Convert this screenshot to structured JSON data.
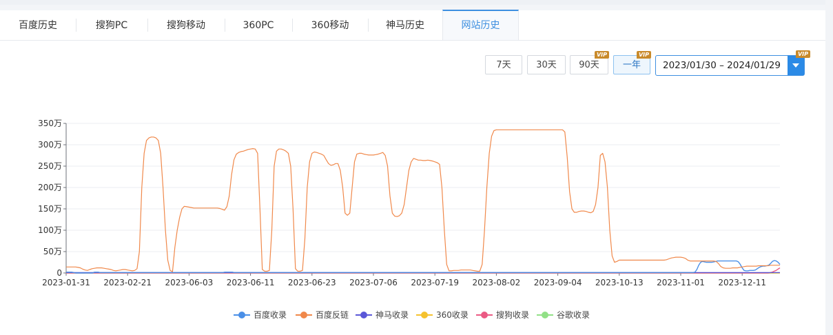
{
  "tabs": [
    {
      "label": "百度历史",
      "active": false
    },
    {
      "label": "搜狗PC",
      "active": false
    },
    {
      "label": "搜狗移动",
      "active": false
    },
    {
      "label": "360PC",
      "active": false
    },
    {
      "label": "360移动",
      "active": false
    },
    {
      "label": "神马历史",
      "active": false
    },
    {
      "label": "网站历史",
      "active": true
    }
  ],
  "range_buttons": [
    {
      "label": "7天",
      "vip": false,
      "selected": false
    },
    {
      "label": "30天",
      "vip": false,
      "selected": false
    },
    {
      "label": "90天",
      "vip": true,
      "selected": false
    },
    {
      "label": "一年",
      "vip": true,
      "selected": true
    }
  ],
  "vip_label": "VIP",
  "date_range": {
    "value": "2023/01/30 – 2024/01/29",
    "vip": true
  },
  "chart_data": {
    "type": "line",
    "ylim": [
      0,
      350
    ],
    "yticks": [
      0,
      50,
      100,
      150,
      200,
      250,
      300,
      350
    ],
    "ytick_labels": [
      "0",
      "50万",
      "100万",
      "150万",
      "200万",
      "250万",
      "300万",
      "350万"
    ],
    "xtick_labels": [
      "2023-01-31",
      "2023-02-21",
      "2023-06-03",
      "2023-06-11",
      "2023-06-23",
      "2023-07-06",
      "2023-07-19",
      "2023-08-02",
      "2023-09-04",
      "2023-10-13",
      "2023-11-01",
      "2023-12-11"
    ],
    "grid": true,
    "legend_position": "bottom",
    "series": [
      {
        "name": "百度收录",
        "color": "#4a8fe7",
        "values": [
          2,
          2,
          2,
          2,
          1,
          0,
          0,
          0,
          0,
          0,
          0,
          0,
          0,
          0,
          0,
          2,
          2,
          2,
          1,
          1,
          1,
          1,
          1,
          1,
          1,
          1,
          1,
          1,
          1,
          1,
          1,
          1,
          1,
          1,
          1,
          1,
          1,
          1,
          1,
          1,
          1,
          1,
          1,
          1,
          1,
          1,
          1,
          1,
          1,
          1,
          1,
          1,
          1,
          1,
          1,
          1,
          1,
          1,
          1,
          1,
          1,
          1,
          1,
          1,
          1,
          1,
          1,
          1,
          1,
          1,
          1,
          1,
          1,
          1,
          1,
          1,
          1,
          1,
          1,
          1,
          1,
          1,
          1,
          1,
          2,
          2,
          2,
          2,
          2,
          1,
          1,
          1,
          1,
          1,
          1,
          1,
          1,
          1,
          1,
          1,
          1,
          1,
          1,
          1,
          1,
          1,
          1,
          1,
          1,
          1,
          1,
          1,
          1,
          1,
          1,
          1,
          1,
          1,
          1,
          1,
          1,
          1,
          1,
          1,
          1,
          1,
          1,
          1,
          1,
          1,
          1,
          1,
          1,
          1,
          1,
          1,
          1,
          1,
          1,
          1,
          1,
          1,
          1,
          1,
          1,
          1,
          1,
          1,
          1,
          1,
          1,
          1,
          1,
          1,
          1,
          1,
          1,
          1,
          1,
          1,
          1,
          1,
          1,
          1,
          1,
          1,
          1,
          1,
          1,
          1,
          1,
          1,
          1,
          1,
          1,
          1,
          1,
          1,
          1,
          1,
          1,
          1,
          1,
          1,
          1,
          1,
          1,
          1,
          1,
          1,
          1,
          1,
          1,
          1,
          1,
          1,
          1,
          1,
          1,
          1,
          1,
          1,
          1,
          1,
          1,
          1,
          1,
          1,
          1,
          1,
          1,
          1,
          1,
          1,
          1,
          1,
          1,
          1,
          1,
          1,
          1,
          1,
          1,
          1,
          1,
          1,
          1,
          1,
          1,
          1,
          1,
          1,
          1,
          1,
          1,
          1,
          1,
          1,
          1,
          1,
          1,
          1,
          1,
          1,
          1,
          1,
          1,
          1,
          1,
          1,
          1,
          1,
          1,
          1,
          1,
          1,
          1,
          1,
          1,
          1,
          1,
          1,
          1,
          1,
          1,
          1,
          1,
          1,
          1,
          1,
          1,
          1,
          1,
          1,
          1,
          1,
          1,
          1,
          1,
          1,
          1,
          1,
          1,
          1,
          1,
          1,
          1,
          1,
          1,
          1,
          1,
          1,
          1,
          1,
          1,
          1,
          1,
          1,
          1,
          1,
          1,
          1,
          1,
          1,
          1,
          1,
          1,
          1,
          1,
          1,
          1,
          1,
          1,
          1,
          1,
          1,
          1,
          1,
          1,
          1,
          1,
          1,
          1,
          1,
          1,
          1,
          1,
          1,
          1,
          1,
          1,
          1,
          1,
          2,
          8,
          18,
          25,
          27,
          26,
          25,
          25,
          25,
          25,
          26,
          27,
          28,
          28,
          28,
          28,
          28,
          28,
          28,
          28,
          28,
          28,
          28,
          26,
          20,
          12,
          6,
          5,
          5,
          6,
          6,
          6,
          7,
          10,
          13,
          15,
          16,
          16,
          17,
          18,
          22,
          27,
          29,
          28,
          25,
          20
        ]
      },
      {
        "name": "百度反链",
        "color": "#f0884a",
        "values": [
          14,
          14,
          14,
          14,
          14,
          13,
          12,
          9,
          7,
          6,
          8,
          10,
          11,
          12,
          12,
          12,
          11,
          10,
          9,
          8,
          6,
          5,
          6,
          7,
          8,
          8,
          7,
          6,
          5,
          6,
          10,
          50,
          200,
          280,
          310,
          316,
          318,
          318,
          316,
          310,
          280,
          200,
          100,
          30,
          6,
          3,
          60,
          100,
          130,
          150,
          156,
          155,
          154,
          153,
          152,
          152,
          152,
          152,
          152,
          152,
          152,
          152,
          152,
          152,
          152,
          151,
          149,
          147,
          155,
          180,
          230,
          265,
          278,
          282,
          284,
          285,
          287,
          289,
          290,
          291,
          290,
          280,
          150,
          8,
          4,
          4,
          6,
          100,
          250,
          285,
          290,
          290,
          288,
          285,
          280,
          250,
          150,
          10,
          4,
          4,
          6,
          80,
          200,
          260,
          280,
          283,
          282,
          280,
          278,
          275,
          265,
          256,
          252,
          253,
          256,
          256,
          240,
          200,
          140,
          135,
          140,
          200,
          260,
          278,
          280,
          280,
          278,
          277,
          276,
          276,
          276,
          277,
          278,
          280,
          282,
          275,
          250,
          180,
          140,
          133,
          132,
          134,
          140,
          160,
          200,
          240,
          260,
          268,
          266,
          264,
          264,
          263,
          263,
          264,
          263,
          262,
          260,
          258,
          254,
          200,
          100,
          20,
          5,
          5,
          6,
          6,
          6,
          7,
          7,
          7,
          7,
          7,
          6,
          5,
          4,
          4,
          20,
          100,
          200,
          280,
          320,
          333,
          335,
          335,
          335,
          335,
          335,
          335,
          335,
          335,
          335,
          335,
          335,
          335,
          335,
          335,
          335,
          335,
          335,
          335,
          335,
          335,
          335,
          335,
          335,
          335,
          335,
          335,
          335,
          335,
          335,
          330,
          270,
          190,
          150,
          142,
          142,
          144,
          145,
          145,
          144,
          142,
          141,
          144,
          160,
          200,
          275,
          280,
          260,
          200,
          100,
          40,
          25,
          27,
          30,
          30,
          30,
          30,
          30,
          30,
          30,
          30,
          30,
          30,
          30,
          30,
          30,
          30,
          30,
          30,
          30,
          30,
          30,
          30,
          31,
          33,
          35,
          36,
          37,
          37,
          37,
          36,
          34,
          30,
          28,
          28,
          28,
          28,
          28,
          28,
          28,
          28,
          28,
          28,
          28,
          27,
          22,
          15,
          12,
          11,
          11,
          11,
          12,
          12,
          12,
          13,
          14,
          15,
          16,
          16,
          16,
          16,
          16,
          17,
          17,
          17,
          17,
          17,
          18,
          18,
          18,
          18,
          18
        ]
      },
      {
        "name": "神马收录",
        "color": "#5a57d8",
        "values": [
          1,
          1,
          1,
          1,
          1,
          1,
          1,
          1,
          1,
          1,
          1,
          1
        ]
      },
      {
        "name": "360收录",
        "color": "#f5c22e",
        "values": [
          0,
          0,
          0,
          0,
          0,
          0,
          0,
          0,
          0,
          0,
          0,
          0
        ]
      },
      {
        "name": "搜狗收录",
        "color": "#eb5a84",
        "values": [
          0,
          0,
          0,
          0,
          0,
          0,
          0,
          0,
          0,
          0,
          0,
          0,
          0,
          0,
          0,
          0,
          0,
          0,
          0,
          0,
          0,
          0,
          0,
          0,
          0,
          0,
          0,
          0,
          0,
          0,
          0,
          0,
          0,
          0,
          0,
          0,
          0,
          0,
          0,
          0,
          0,
          0,
          0,
          0,
          0,
          0,
          0,
          0,
          0,
          0,
          0,
          0,
          0,
          0,
          0,
          0,
          0,
          0,
          0,
          0,
          0,
          0,
          0,
          0,
          0,
          0,
          0,
          0,
          0,
          0,
          0,
          0,
          0,
          0,
          0,
          0,
          0,
          0,
          0,
          0,
          0,
          0,
          0,
          0,
          0,
          0,
          0,
          0,
          0,
          0,
          0,
          0,
          0,
          0,
          0,
          0,
          0,
          0,
          0,
          0,
          0,
          0,
          0,
          0,
          0,
          0,
          0,
          0,
          0,
          0,
          0,
          0,
          0,
          0,
          0,
          0,
          0,
          0,
          0,
          0,
          0,
          0,
          0,
          0,
          0,
          0,
          0,
          0,
          0,
          0,
          0,
          0,
          0,
          0,
          0,
          0,
          0,
          0,
          0,
          0,
          0,
          0,
          0,
          0,
          0,
          0,
          0,
          0,
          0,
          0,
          0,
          0,
          0,
          0,
          0,
          0,
          0,
          0,
          0,
          0,
          0,
          0,
          0,
          0,
          0,
          0,
          0,
          0,
          0,
          0,
          0,
          0,
          0,
          0,
          0,
          0,
          0,
          0,
          0,
          0,
          0,
          0,
          0,
          0,
          0,
          0,
          0,
          0,
          0,
          0,
          0,
          0,
          0,
          0,
          0,
          0,
          0,
          0,
          0,
          0,
          0,
          0,
          0,
          0,
          0,
          0,
          0,
          0,
          0,
          0,
          0,
          0,
          0,
          0,
          0,
          0,
          0,
          0,
          0,
          0,
          0,
          0,
          0,
          0,
          0,
          0,
          0,
          0,
          0,
          0,
          0,
          0,
          0,
          0,
          0,
          0,
          0,
          0,
          0,
          0,
          0,
          0,
          0,
          0,
          0,
          0,
          0,
          0,
          0,
          0,
          0,
          0,
          0,
          0,
          0,
          0,
          0,
          0,
          0,
          0,
          0,
          0,
          0,
          0,
          0,
          0,
          0,
          0,
          0,
          0,
          0,
          0,
          0,
          0,
          0,
          0,
          0,
          0,
          0,
          0,
          0,
          0,
          0,
          0,
          0,
          0,
          0,
          0,
          0,
          0,
          0,
          0,
          0,
          0,
          0,
          0,
          0,
          0,
          0,
          0,
          0,
          0,
          0,
          0,
          0,
          0,
          0,
          0,
          0,
          0,
          0,
          0,
          0,
          0,
          0,
          0,
          0,
          0,
          0,
          0,
          0,
          0,
          0,
          0,
          0,
          0,
          0,
          0,
          0,
          0,
          0,
          0,
          0,
          0,
          0,
          0,
          0,
          0,
          0,
          0,
          0,
          0,
          0,
          0,
          0,
          0,
          0,
          0,
          0,
          0,
          0,
          0,
          0,
          0,
          0,
          0,
          0,
          0,
          0,
          0,
          0,
          0,
          0,
          0,
          0,
          0,
          0,
          1,
          2,
          4,
          6,
          9,
          12
        ]
      },
      {
        "name": "谷歌收录",
        "color": "#91e086",
        "values": [
          0,
          0,
          0,
          0,
          0,
          0,
          0,
          0,
          0,
          0,
          0,
          0
        ]
      }
    ]
  }
}
